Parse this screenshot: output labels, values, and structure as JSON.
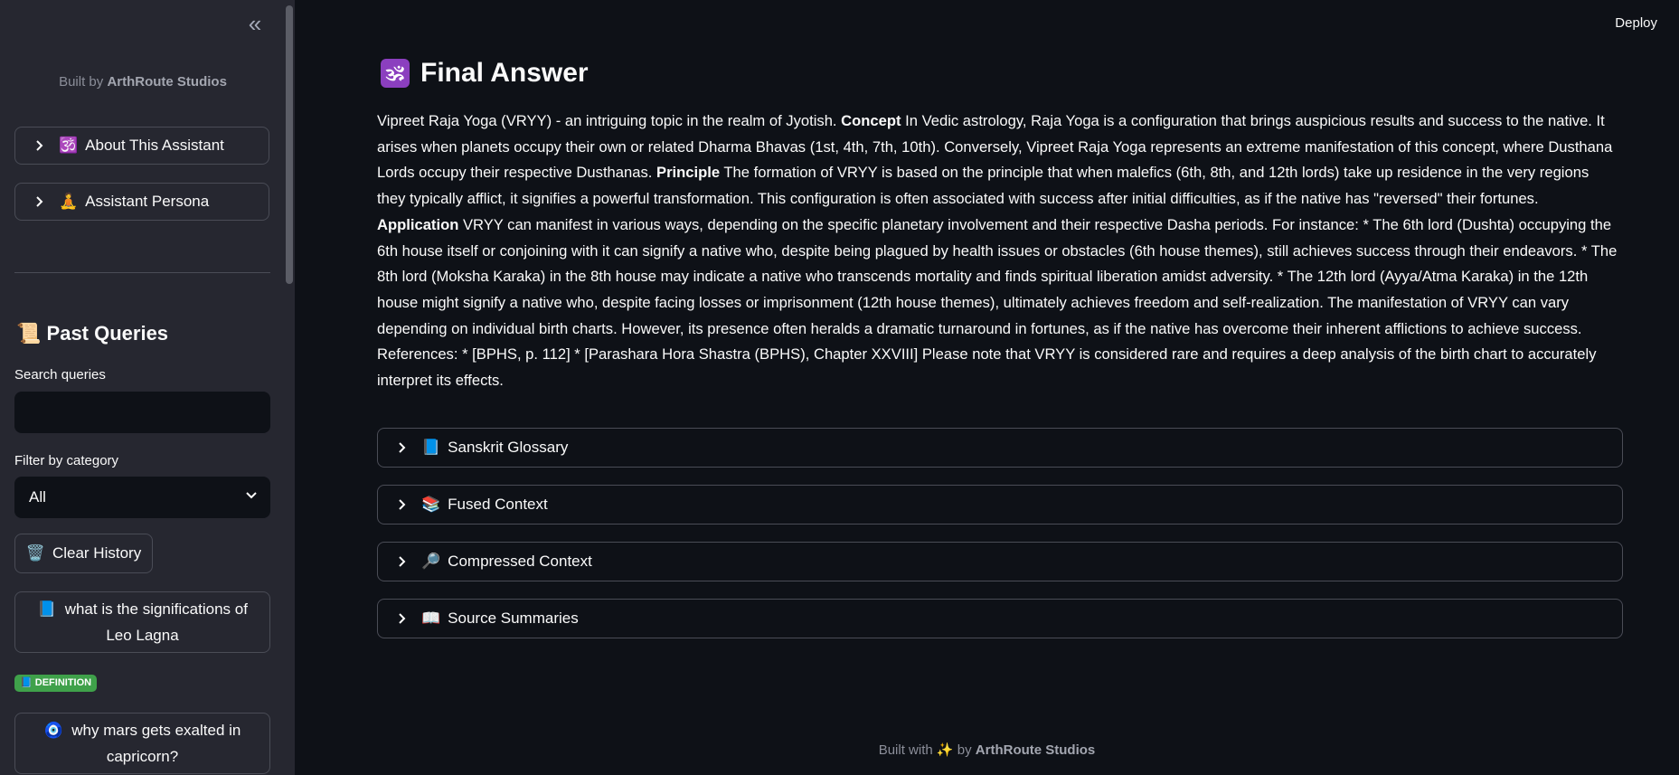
{
  "sidebar": {
    "collapse_icon": "«",
    "built_by_prefix": "Built by",
    "built_by_name": "ArthRoute Studios",
    "expanders": [
      {
        "icon": "🕉️",
        "label": "About This Assistant"
      },
      {
        "icon": "🧘",
        "label": "Assistant Persona"
      }
    ],
    "past_queries": {
      "icon": "📜",
      "title": "Past Queries"
    },
    "search": {
      "label": "Search queries",
      "value": ""
    },
    "filter": {
      "label": "Filter by category",
      "selected": "All"
    },
    "clear_history": {
      "icon": "🗑️",
      "label": "Clear History"
    },
    "queries": [
      {
        "icon": "📘",
        "text": "what is the significations of Leo Lagna"
      },
      {
        "icon": "🧿",
        "text": "why mars gets exalted in capricorn?"
      }
    ],
    "badge": {
      "icon": "📘",
      "text": "DEFINITION",
      "color": "#3fa14a"
    }
  },
  "header": {
    "deploy_label": "Deploy"
  },
  "main": {
    "title_icon": "🕉",
    "title": "Final Answer",
    "answer": [
      {
        "bold": false,
        "text": "Vipreet Raja Yoga (VRYY) - an intriguing topic in the realm of Jyotish. "
      },
      {
        "bold": true,
        "text": "Concept"
      },
      {
        "bold": false,
        "text": " In Vedic astrology, Raja Yoga is a configuration that brings auspicious results and success to the native. It arises when planets occupy their own or related Dharma Bhavas (1st, 4th, 7th, 10th). Conversely, Vipreet Raja Yoga represents an extreme manifestation of this concept, where Dusthana Lords occupy their respective Dusthanas. "
      },
      {
        "bold": true,
        "text": "Principle"
      },
      {
        "bold": false,
        "text": " The formation of VRYY is based on the principle that when malefics (6th, 8th, and 12th lords) take up residence in the very regions they typically afflict, it signifies a powerful transformation. This configuration is often associated with success after initial difficulties, as if the native has \"reversed\" their fortunes. "
      },
      {
        "bold": true,
        "text": "Application"
      },
      {
        "bold": false,
        "text": " VRYY can manifest in various ways, depending on the specific planetary involvement and their respective Dasha periods. For instance: * The 6th lord (Dushta) occupying the 6th house itself or conjoining with it can signify a native who, despite being plagued by health issues or obstacles (6th house themes), still achieves success through their endeavors. * The 8th lord (Moksha Karaka) in the 8th house may indicate a native who transcends mortality and finds spiritual liberation amidst adversity. * The 12th lord (Ayya/Atma Karaka) in the 12th house might signify a native who, despite facing losses or imprisonment (12th house themes), ultimately achieves freedom and self-realization. The manifestation of VRYY can vary depending on individual birth charts. However, its presence often heralds a dramatic turnaround in fortunes, as if the native has overcome their inherent afflictions to achieve success. References: * [BPHS, p. 112] * [Parashara Hora Shastra (BPHS), Chapter XXVIII] Please note that VRYY is considered rare and requires a deep analysis of the birth chart to accurately interpret its effects."
      }
    ],
    "expanders": [
      {
        "icon": "📘",
        "label": "Sanskrit Glossary"
      },
      {
        "icon": "📚",
        "label": "Fused Context"
      },
      {
        "icon": "🔎",
        "label": "Compressed Context"
      },
      {
        "icon": "📖",
        "label": "Source Summaries"
      }
    ]
  },
  "footer": {
    "prefix": "Built with",
    "icon": "✨",
    "by": "by",
    "name": "ArthRoute Studios"
  },
  "colors": {
    "background": "#0e1117",
    "sidebar": "#262730",
    "accent_badge": "#3fa14a"
  }
}
